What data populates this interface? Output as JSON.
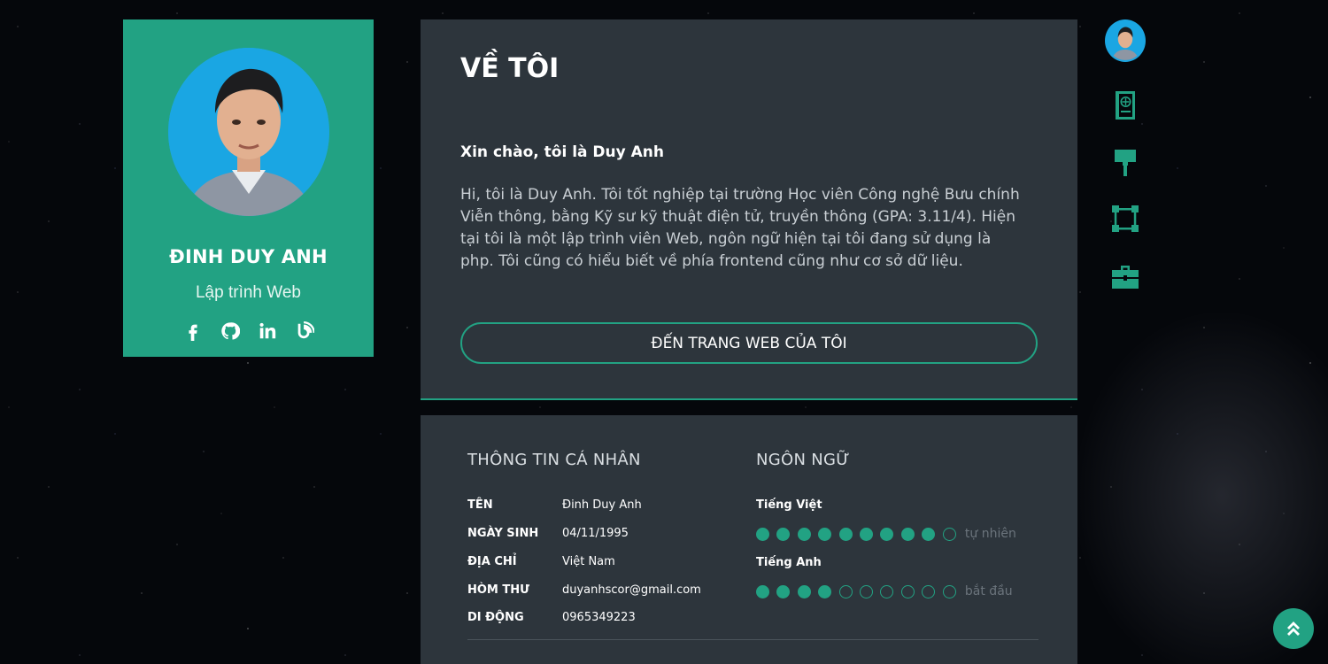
{
  "profile": {
    "name": "ĐINH DUY ANH",
    "role": "Lập trình Web",
    "social_icons": [
      "facebook-icon",
      "github-icon",
      "linkedin-icon",
      "blog-icon"
    ]
  },
  "about": {
    "title": "VỀ TÔI",
    "greeting": "Xin chào, tôi là Duy Anh",
    "description": "Hi, tôi là Duy Anh. Tôi tốt nghiệp tại trường Học viên Công nghệ Bưu chính Viễn thông, bằng Kỹ sư kỹ thuật điện tử, truyền thông (GPA: 3.11/4). Hiện tại tôi là một lập trình viên Web, ngôn ngữ hiện tại tôi đang sử dụng là php. Tôi cũng có hiểu biết về phía frontend cũng như cơ sở dữ liệu.",
    "button_label": "ĐẾN TRANG WEB CỦA TÔI"
  },
  "personal_info": {
    "title": "THÔNG TIN CÁ NHÂN",
    "rows": [
      {
        "label": "TÊN",
        "value": "Đinh Duy Anh"
      },
      {
        "label": "NGÀY SINH",
        "value": "04/11/1995"
      },
      {
        "label": "ĐỊA CHỈ",
        "value": "Việt Nam"
      },
      {
        "label": "HÒM THƯ",
        "value": "duyanhscor@gmail.com"
      },
      {
        "label": "DI ĐỘNG",
        "value": "0965349223"
      }
    ]
  },
  "languages": {
    "title": "NGÔN NGỮ",
    "items": [
      {
        "name": "Tiếng Việt",
        "rating": 9,
        "max": 10,
        "level": "tự nhiên"
      },
      {
        "name": "Tiếng Anh",
        "rating": 4,
        "max": 10,
        "level": "bắt đầu"
      }
    ]
  },
  "side_nav": {
    "icons": [
      "avatar",
      "passport-book-icon",
      "paint-roller-icon",
      "vector-square-icon",
      "briefcase-icon"
    ]
  },
  "colors": {
    "accent": "#22a283",
    "panel": "#2d353c",
    "avatar_bg": "#1aa6e3"
  }
}
